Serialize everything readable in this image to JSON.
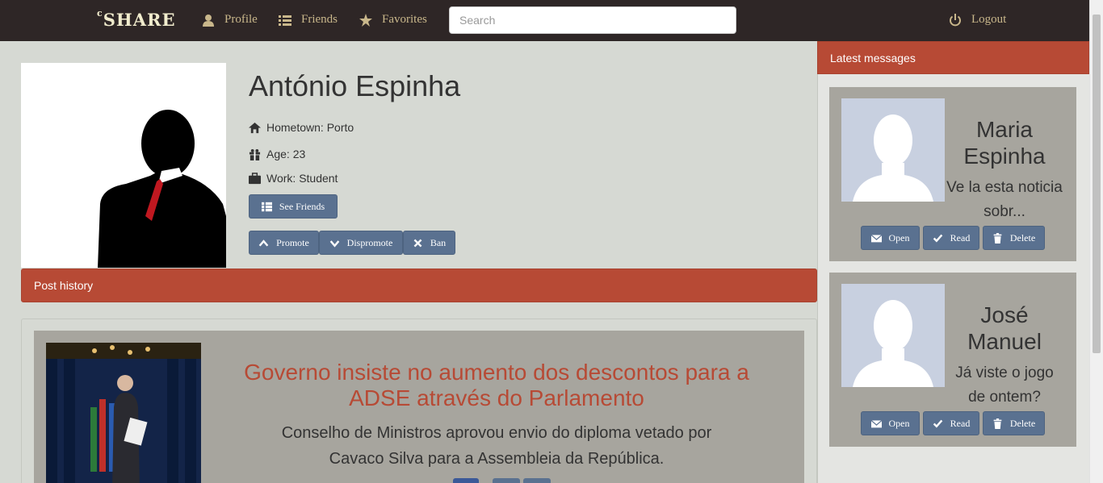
{
  "nav": {
    "brand": "SHARE",
    "brand_prefix": "c",
    "profile": "Profile",
    "friends": "Friends",
    "favorites": "Favorites",
    "search_placeholder": "Search",
    "logout": "Logout"
  },
  "profile": {
    "name": "António Espinha",
    "hometown": "Hometown: Porto",
    "age": "Age: 23",
    "work": "Work: Student",
    "see_friends": "See Friends",
    "promote": "Promote",
    "dispromote": "Dispromote",
    "ban": "Ban"
  },
  "posts": {
    "header": "Post history",
    "items": [
      {
        "title": "Governo insiste no aumento dos descontos para a ADSE através do Parlamento",
        "description": "Conselho de Ministros aprovou envio do diploma vetado por Cavaco Silva para a Assembleia da República."
      }
    ]
  },
  "messages": {
    "header": "Latest messages",
    "items": [
      {
        "name": "Maria Espinha",
        "preview": "Ve la esta noticia sobr...",
        "open": "Open",
        "read": "Read",
        "delete": "Delete"
      },
      {
        "name": "José Manuel",
        "preview": "Já viste o jogo de ontem?",
        "open": "Open",
        "read": "Read",
        "delete": "Delete"
      }
    ]
  },
  "colors": {
    "navbar": "#2e2626",
    "accent_red": "#b74a35",
    "button_blue": "#5a7190",
    "card_gray": "#a7a59e",
    "page_bg": "#d6d9d3"
  }
}
